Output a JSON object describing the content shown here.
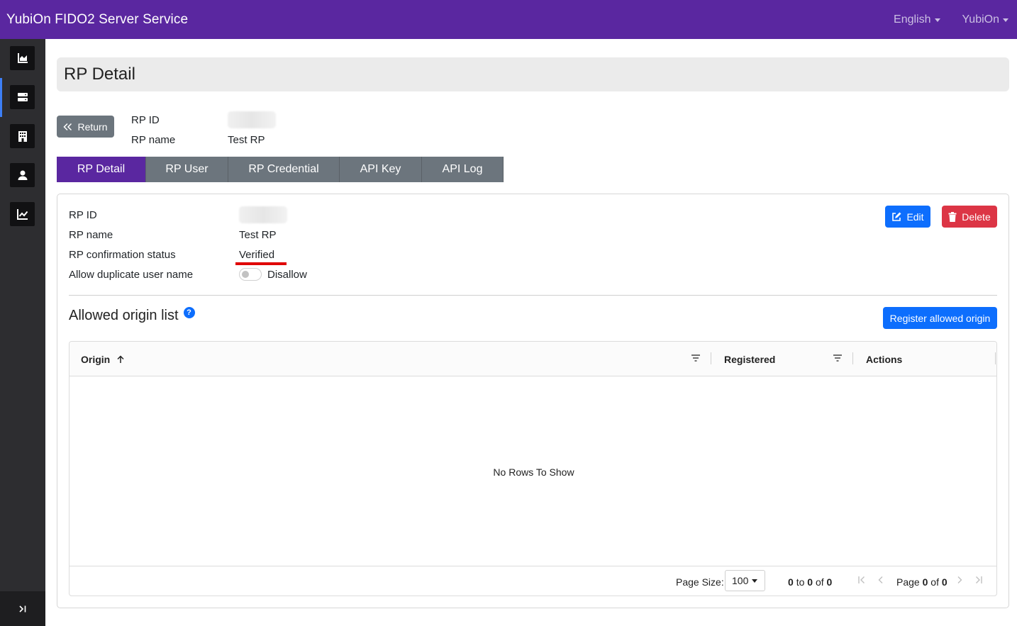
{
  "app": {
    "title": "YubiOn FIDO2 Server Service"
  },
  "topnav": {
    "language": "English",
    "user": "YubiOn"
  },
  "sidebar": {
    "items": [
      {
        "name": "dashboard",
        "icon": "area-chart-icon"
      },
      {
        "name": "server",
        "icon": "server-icon"
      },
      {
        "name": "organization",
        "icon": "building-icon"
      },
      {
        "name": "user",
        "icon": "person-icon"
      },
      {
        "name": "statistics",
        "icon": "line-chart-icon"
      }
    ],
    "toggle_icon": "chevron-bar-right-icon"
  },
  "page": {
    "title": "RP Detail"
  },
  "return_button": {
    "label": "Return"
  },
  "summary": {
    "rp_id_label": "RP ID",
    "rp_name_label": "RP name",
    "rp_name_value": "Test RP"
  },
  "tabs": [
    {
      "label": "RP Detail",
      "active": true
    },
    {
      "label": "RP User",
      "active": false
    },
    {
      "label": "RP Credential",
      "active": false
    },
    {
      "label": "API Key",
      "active": false
    },
    {
      "label": "API Log",
      "active": false
    }
  ],
  "detail": {
    "rp_id_label": "RP ID",
    "rp_name_label": "RP name",
    "rp_name_value": "Test RP",
    "status_label": "RP confirmation status",
    "status_value": "Verified",
    "dup_label": "Allow duplicate user name",
    "dup_value": "Disallow"
  },
  "actions": {
    "edit_label": "Edit",
    "delete_label": "Delete"
  },
  "origins": {
    "title": "Allowed origin list",
    "register_label": "Register allowed origin",
    "columns": {
      "origin": "Origin",
      "registered": "Registered",
      "actions": "Actions"
    },
    "empty_text": "No Rows To Show",
    "footer": {
      "page_size_label": "Page Size:",
      "page_size_value": "100",
      "range_from": "0",
      "range_to_word": "to",
      "range_to": "0",
      "range_of_word": "of",
      "range_total": "0",
      "page_word": "Page",
      "page_current": "0",
      "page_of_word": "of",
      "page_total": "0"
    }
  },
  "colors": {
    "brand": "#5a27a0",
    "primary": "#0d6efd",
    "danger": "#dc3545",
    "secondary": "#6c757d",
    "highlight": "#e00000"
  }
}
